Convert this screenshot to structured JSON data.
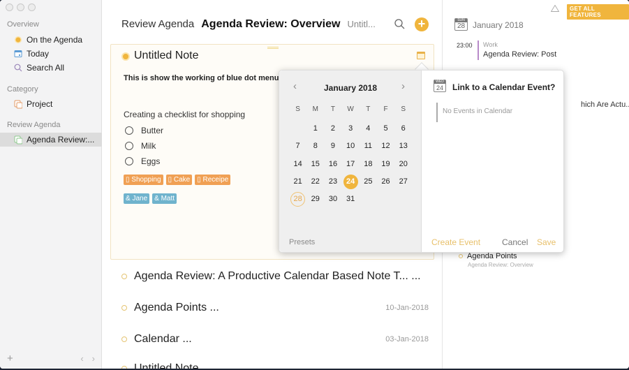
{
  "sidebar": {
    "sections": {
      "overview": "Overview",
      "category": "Category",
      "review_agenda": "Review Agenda"
    },
    "items": [
      {
        "label": "On the Agenda",
        "icon": "agenda-dot-icon"
      },
      {
        "label": "Today",
        "icon": "calendar-today-icon"
      },
      {
        "label": "Search All",
        "icon": "search-icon"
      },
      {
        "label": "Project",
        "icon": "project-icon"
      },
      {
        "label": "Agenda Review:...",
        "icon": "project-icon",
        "active": true
      }
    ],
    "add_label": "+",
    "back_label": "‹",
    "forward_label": "›"
  },
  "header": {
    "breadcrumb_parent": "Review Agenda",
    "breadcrumb_current": "Agenda Review: Overview",
    "breadcrumb_child": "Untitl...",
    "add_label": "+"
  },
  "note": {
    "title": "Untitled Note",
    "bold_line": "This is show the working of blue dot menu",
    "line": "Creating a checklist for shopping",
    "checklist": [
      "Butter",
      "Milk",
      "Eggs"
    ],
    "tags": [
      "Shopping",
      "Cake",
      "Receipe"
    ],
    "people": [
      "Jane",
      "Matt"
    ],
    "tag_glyph": "▯",
    "person_glyph": "&"
  },
  "list": [
    {
      "title": "Agenda Review: A Productive Calendar Based Note T...  ...",
      "date": ""
    },
    {
      "title": "Agenda Points  ...",
      "date": "10-Jan-2018"
    },
    {
      "title": "Calendar  ...",
      "date": "03-Jan-2018"
    },
    {
      "title": "Untitled Note",
      "date": ""
    }
  ],
  "right": {
    "get_all_features": "GET ALL FEATURES",
    "day_dow": "SUN",
    "day_num": "28",
    "month": "January 2018",
    "event": {
      "time": "23:00",
      "category": "Work",
      "title": "Agenda Review: Post"
    },
    "partial_title": "hich Are Actu...",
    "item": {
      "title": "Agenda Points",
      "subtitle": "Agenda Review: Overview"
    }
  },
  "popover": {
    "month": "January 2018",
    "prev": "‹",
    "next": "›",
    "dow": [
      "S",
      "M",
      "T",
      "W",
      "T",
      "F",
      "S"
    ],
    "days": [
      "",
      "1",
      "2",
      "3",
      "4",
      "5",
      "6",
      "7",
      "8",
      "9",
      "10",
      "11",
      "12",
      "13",
      "14",
      "15",
      "16",
      "17",
      "18",
      "19",
      "20",
      "21",
      "22",
      "23",
      "24",
      "25",
      "26",
      "27",
      "28",
      "29",
      "30",
      "31"
    ],
    "selected_day": "24",
    "today_day": "28",
    "presets": "Presets",
    "link_dow": "WED",
    "link_num": "24",
    "link_title": "Link to a Calendar Event?",
    "no_events": "No Events in Calendar",
    "create_event": "Create Event",
    "cancel": "Cancel",
    "save": "Save"
  },
  "colors": {
    "accent": "#f0b53d",
    "tag_orange": "#f0a054",
    "tag_blue": "#6fb3cd",
    "event_bar": "#b88ac9"
  }
}
